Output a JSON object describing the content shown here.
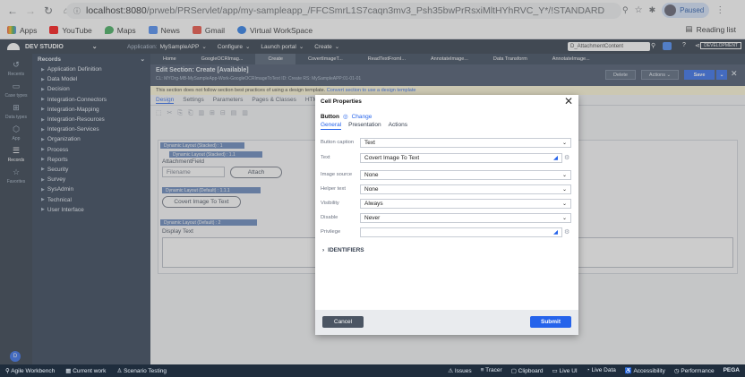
{
  "browser": {
    "url_host": "localhost:8080",
    "url_path": "/prweb/PRServlet/app/my-sampleapp_/FFCSmrL1S7caqn3mv3_Psh35bwPrRsxiMltHYhRVC_Y*/!STANDARD",
    "paused_label": "Paused",
    "bookmarks": [
      "Apps",
      "YouTube",
      "Maps",
      "News",
      "Gmail",
      "Virtual WorkSpace"
    ],
    "reading_list": "Reading list"
  },
  "pega_header": {
    "studio": "DEV STUDIO",
    "application_label": "Application:",
    "application_value": "MySampleAPP",
    "configure": "Configure",
    "launch_portal": "Launch portal",
    "create": "Create",
    "search_value": "D_AttachmentContent",
    "developer": "DEVELOPMENT"
  },
  "rail": {
    "items": [
      "Recents",
      "Case types",
      "Data types",
      "App",
      "Records",
      "Favorites"
    ],
    "badge": "D"
  },
  "records": {
    "title": "Records",
    "items": [
      "Application Definition",
      "Data Model",
      "Decision",
      "Integration-Connectors",
      "Integration-Mapping",
      "Integration-Resources",
      "Integration-Services",
      "Organization",
      "Process",
      "Reports",
      "Security",
      "Survey",
      "SysAdmin",
      "Technical",
      "User Interface"
    ]
  },
  "tabs": [
    "Home",
    "GoogleOCRImag...",
    "Create",
    "CovertImageT...",
    "ReadTextFromI...",
    "AnnotateImage...",
    "Data Transform",
    "AnnotateImage..."
  ],
  "section": {
    "title": "Edit Section: Create [Available]",
    "subtitle": "CL: MYOrg-MB-MySampleApp-Work-GoogleOCRImageToText    ID: Create    RS: MySampleAPP:01-01-01",
    "delete": "Delete",
    "actions": "Actions",
    "save": "Save",
    "warning": "This section does not follow section best practices of using a design template.",
    "warning_link": "Convert section to use a design template"
  },
  "subtabs": [
    "Design",
    "Settings",
    "Parameters",
    "Pages & Classes",
    "HTML"
  ],
  "canvas": {
    "layout1": "Dynamic Layout (Stacked) : 1",
    "layout11": "Dynamic Layout (Stacked) : 1.1",
    "attach_label": "AttachmentField",
    "filename_placeholder": "Filename",
    "attach_button": "Attach",
    "layout111": "Dynamic Layout (Default) : 1.1.1",
    "covert_button": "Covert Image To Text",
    "layout2": "Dynamic Layout (Default) : 2",
    "display_text": "Display Text"
  },
  "modal": {
    "title": "Cell Properties",
    "control": "Button",
    "change": "Change",
    "tabs": [
      "General",
      "Presentation",
      "Actions"
    ],
    "rows": [
      {
        "label": "Button caption",
        "value": "Text"
      },
      {
        "label": "Text",
        "value": "Covert Image To Text"
      },
      {
        "label": "Image source",
        "value": "None"
      },
      {
        "label": "Helper text",
        "value": "None"
      },
      {
        "label": "Visibility",
        "value": "Always"
      },
      {
        "label": "Disable",
        "value": "Never"
      },
      {
        "label": "Privilege",
        "value": ""
      }
    ],
    "identifiers": "IDENTIFIERS",
    "cancel": "Cancel",
    "submit": "Submit"
  },
  "bottom": {
    "left": [
      "Agile Workbench",
      "Current work",
      "Scenario Testing"
    ],
    "right": [
      "Issues",
      "Tracer",
      "Clipboard",
      "Live UI",
      "Live Data",
      "Accessibility",
      "Performance",
      "PEGA"
    ]
  },
  "colors": {
    "accent": "#2563eb",
    "dark": "#1f2d3d"
  }
}
